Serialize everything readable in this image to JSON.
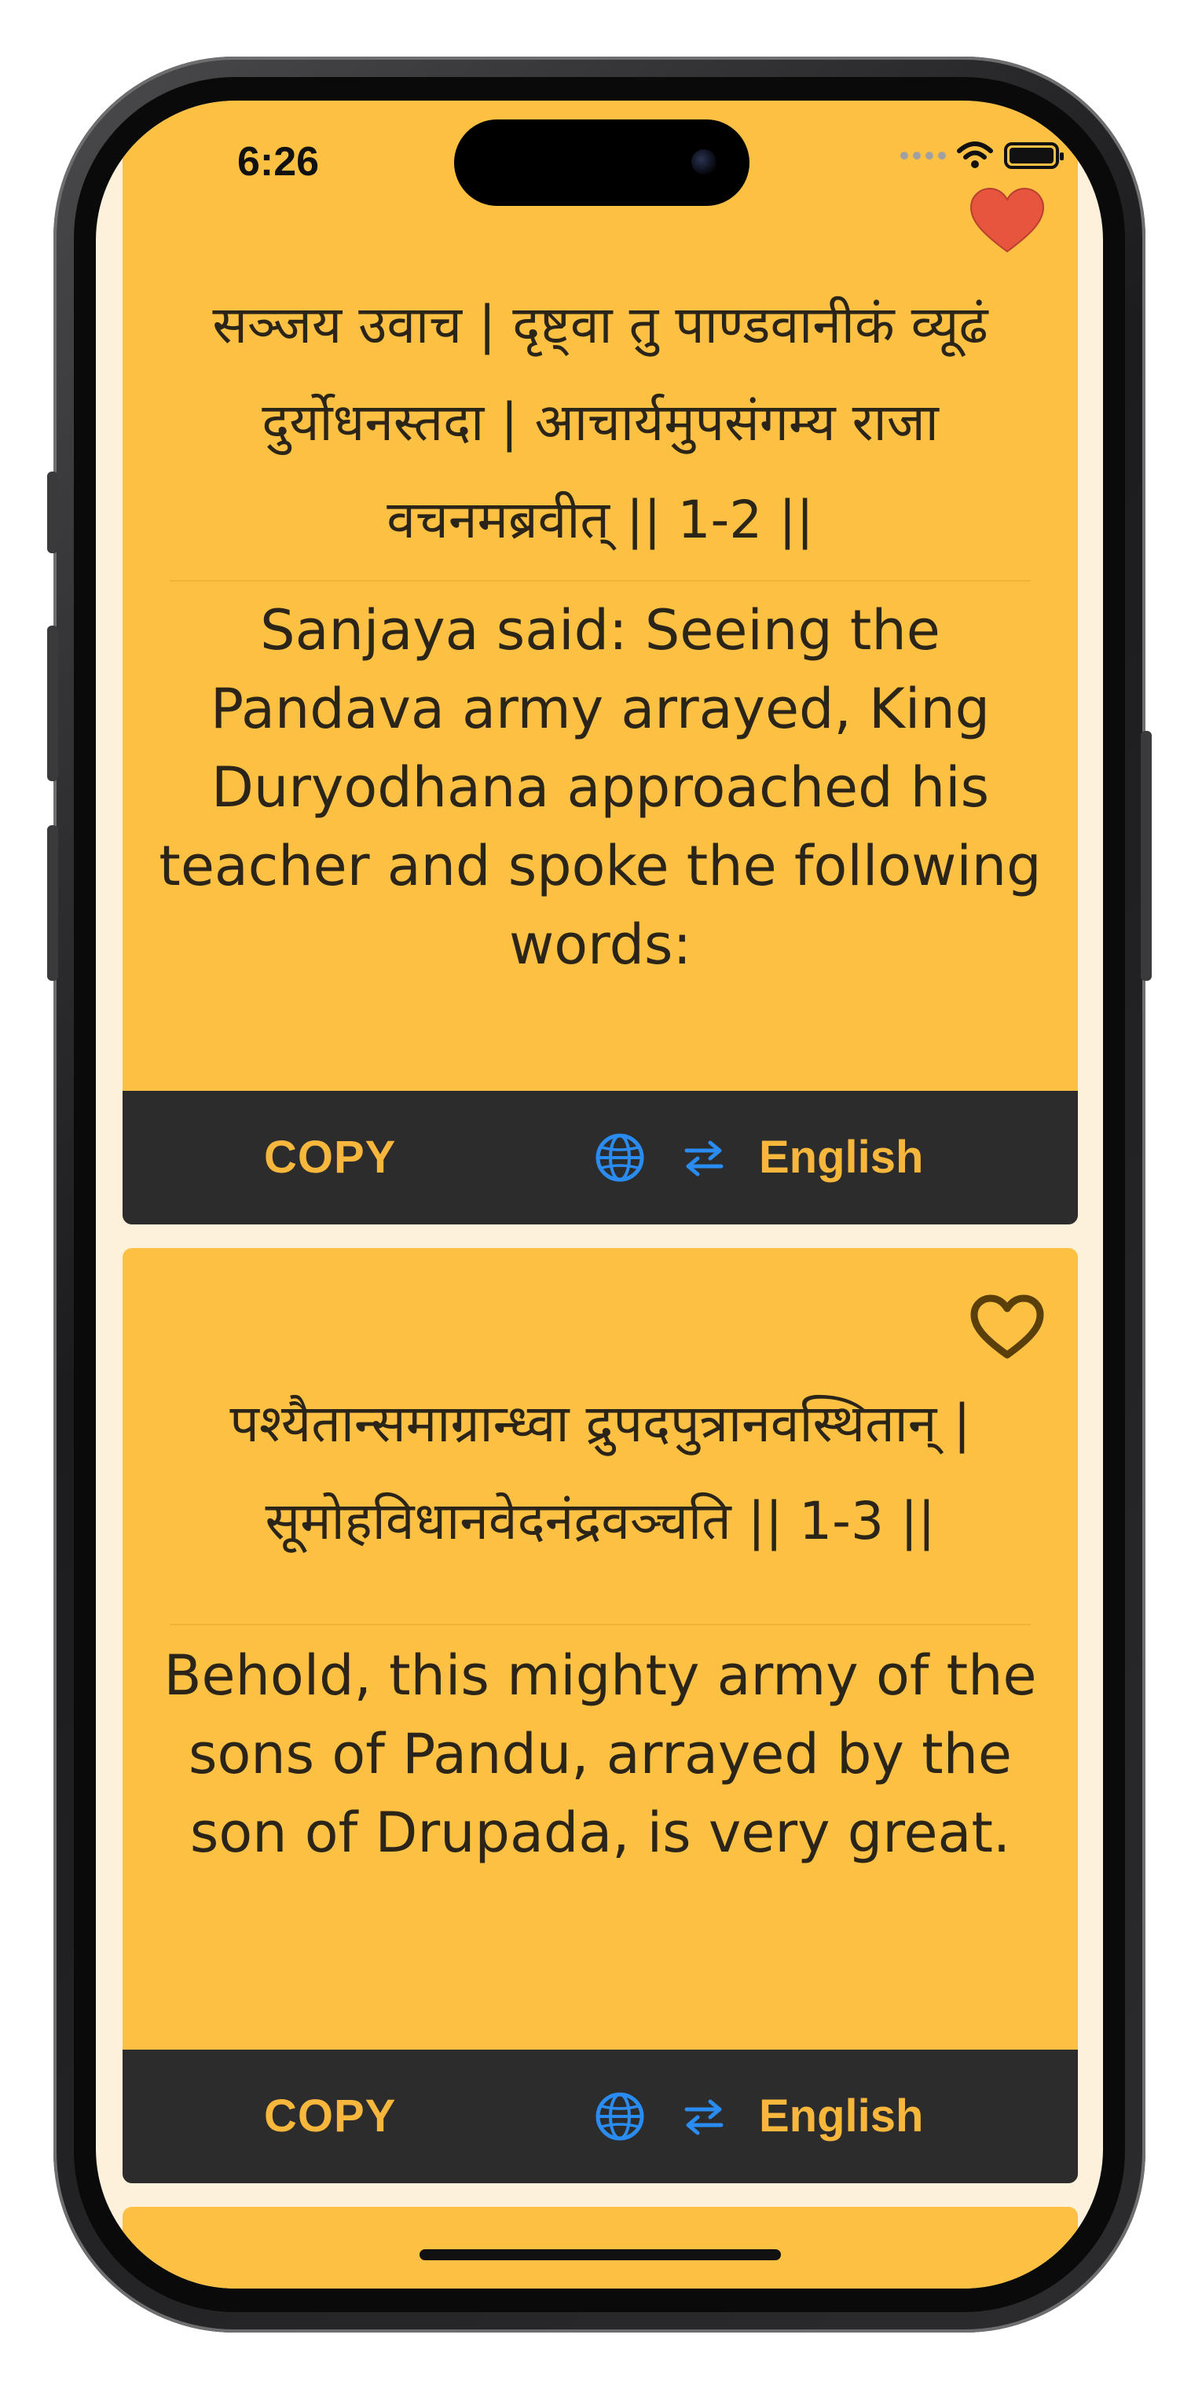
{
  "status_bar": {
    "time": "6:26"
  },
  "verses": [
    {
      "sanskrit": "सञ्जय उवाच | दृष्ट्वा तु पाण्डवानीकं व्यूढं दुर्योधनस्तदा | आचार्यमुपसंगम्य राजा वचनमब्रवीत् || 1-2 ||",
      "translation": "Sanjaya said: Seeing the Pandava army arrayed, King Duryodhana approached his teacher and spoke the following words:",
      "favorited": true
    },
    {
      "sanskrit": "पश्यैतान्समाग्रान्ध्वा द्रुपदपुत्रानवस्थितान् | सूमोहविधानवेदनंद्रवञ्चति || 1-3 ||",
      "translation": "Behold, this mighty army of the sons of Pandu, arrayed by the son of Drupada, is very great.",
      "favorited": false
    }
  ],
  "actions": {
    "copy_label": "COPY",
    "language_label": "English",
    "globe_icon": "globe-icon",
    "swap_icon": "swap-arrows-icon"
  },
  "colors": {
    "card": "#fcc142",
    "action_bar": "#2c2c2c",
    "action_text": "#f6b73c",
    "icon_blue": "#2a8cf0",
    "heart_filled": "#e8553e",
    "heart_outline": "#5a3f0a",
    "background": "#fdf1dc"
  }
}
